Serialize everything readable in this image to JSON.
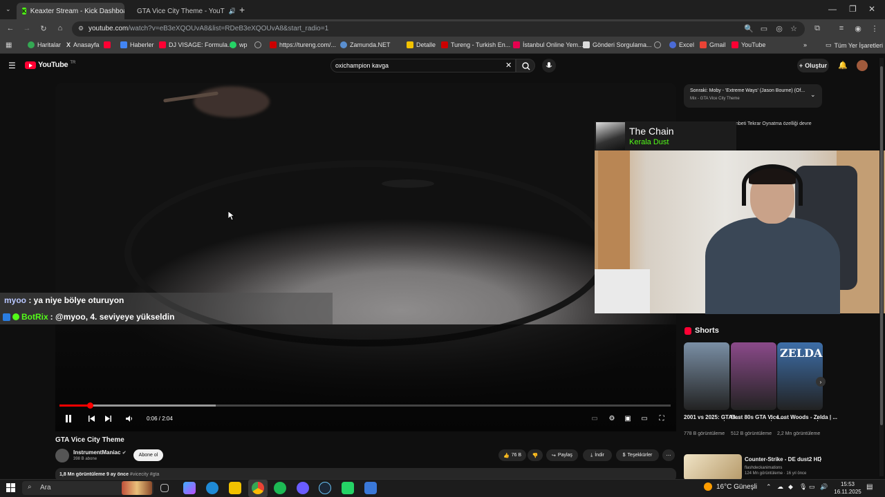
{
  "browser": {
    "tabs": [
      {
        "label": "Kеaxter Stream - Kick Dashboar",
        "active": true
      },
      {
        "label": "GTA Vice City Theme - YouT",
        "active": false
      }
    ],
    "url": {
      "host": "youtube.com",
      "path": "/watch?v=eB3eXQOUvA8&list=RDeB3eXQOUvA8&start_radio=1"
    },
    "bookmarks": [
      "Haritalar",
      "Anasayfa",
      "Haberler",
      "DJ VISAGE: Formula...",
      "wp",
      "https://tureng.com/...",
      "Zamunda.NET",
      "Detalle",
      "Tureng - Turkish En...",
      "İstanbul Online Yem...",
      "Gönderi Sorgulama...",
      "Excel",
      "Gmail",
      "YouTube"
    ],
    "all_bookmarks": "Tüm Yer İşaretleri"
  },
  "youtube": {
    "logo": "YouTube",
    "region": "TR",
    "search_value": "oxichampion kavga",
    "create_label": "Oluştur"
  },
  "player": {
    "time": "0:06 / 2:04",
    "progress_fraction": 0.05
  },
  "chat": [
    {
      "user": "myoo",
      "text": " : ya niye bölye oturuyon"
    },
    {
      "user": "BotRix",
      "text": " : @myoo, 4. seviyeye yükseldin"
    }
  ],
  "next_up": {
    "title": "Sonraki: Moby - 'Extreme Ways' (Jason Bourne) (Of...",
    "subtitle": "Mix - GTA Vice City Theme"
  },
  "overlay": {
    "song_title": "The Chain",
    "song_artist": "Kerala Dust",
    "note": "nbeti Tekrar Oynatma özelliği devre"
  },
  "video": {
    "title": "GTA Vice City Theme",
    "channel": "InstrumentManiac",
    "subscribers": "398 B abone",
    "subscribe_label": "Abone ol",
    "likes": "76 B",
    "share_label": "Paylaş",
    "download_label": "İndir",
    "thanks_label": "Teşekkürler",
    "desc_stats": "1,8 Mn görüntüleme  9 ay önce",
    "desc_tags": "#vicecity #gta"
  },
  "shorts": {
    "heading": "Shorts",
    "items": [
      {
        "title": "2001 vs 2025: GTA I...",
        "views": "778 B görüntüleme",
        "color": "#7a8fa5"
      },
      {
        "title": "Best 80s GTA Vice ...",
        "views": "512 B görüntüleme",
        "color": "#8b4a8a"
      },
      {
        "title": "Lost Woods - Zelda | ...",
        "views": "2,2 Mn görüntüleme",
        "color": "#3d6ea8"
      }
    ]
  },
  "related": {
    "title": "Counter-Strike - DE dust2 HD",
    "channel": "flashdeckanimations",
    "views": "124 Mn görüntüleme · 16 yıl önce"
  },
  "taskbar": {
    "search": "Ara",
    "weather": "16°C  Güneşli",
    "time": "15:53",
    "date": "16.11.2025"
  }
}
